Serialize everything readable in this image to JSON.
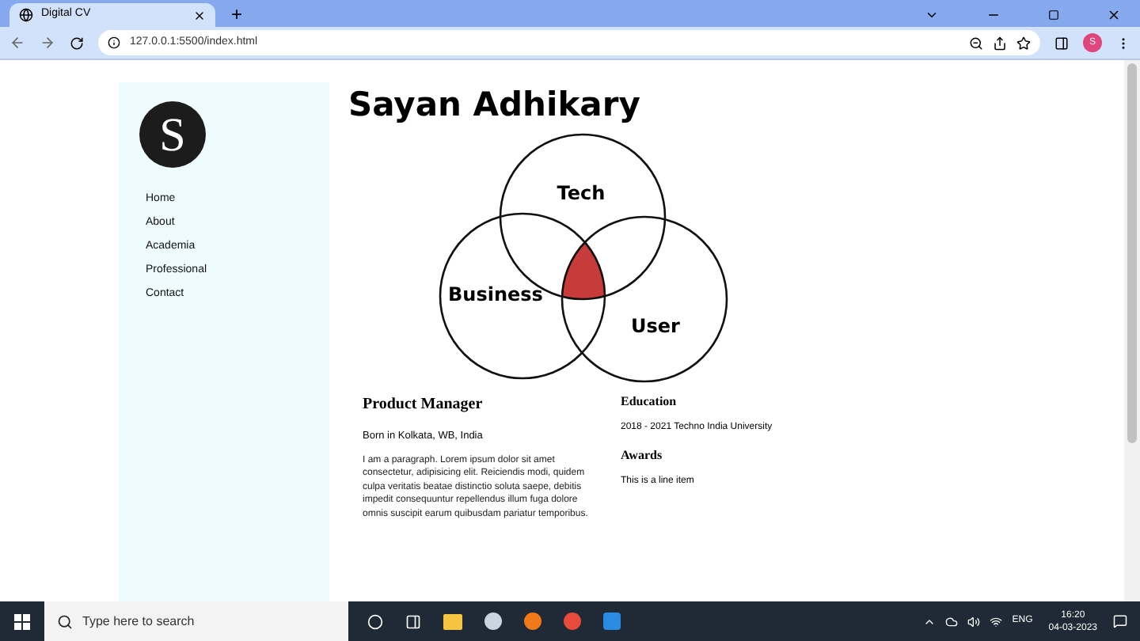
{
  "browser": {
    "tab_title": "Digital CV",
    "new_tab": "+",
    "url": "127.0.0.1:5500/index.html",
    "profile_initial": "S"
  },
  "sidebar": {
    "logo_letter": "S",
    "items": [
      {
        "label": "Home"
      },
      {
        "label": "About"
      },
      {
        "label": "Academia"
      },
      {
        "label": "Professional"
      },
      {
        "label": "Contact"
      }
    ]
  },
  "header": {
    "name": "Sayan Adhikary"
  },
  "venn": {
    "labels": [
      "Tech",
      "Business",
      "User"
    ]
  },
  "profile": {
    "role": "Product Manager",
    "born": "Born in Kolkata, WB, India",
    "paragraph": "I am a paragraph. Lorem ipsum dolor sit amet consectetur, adipisicing elit. Reiciendis modi, quidem culpa veritatis beatae distinctio soluta saepe, debitis impedit consequuntur repellendus illum fuga dolore omnis suscipit earum quibusdam pariatur temporibus."
  },
  "side_sections": [
    {
      "heading": "Education",
      "text": "2018 - 2021 Techno India University"
    },
    {
      "heading": "Awards",
      "text": "This is a line item"
    }
  ],
  "taskbar": {
    "search_placeholder": "Type here to search",
    "language": "ENG",
    "time": "16:20",
    "date": "04-03-2023"
  }
}
